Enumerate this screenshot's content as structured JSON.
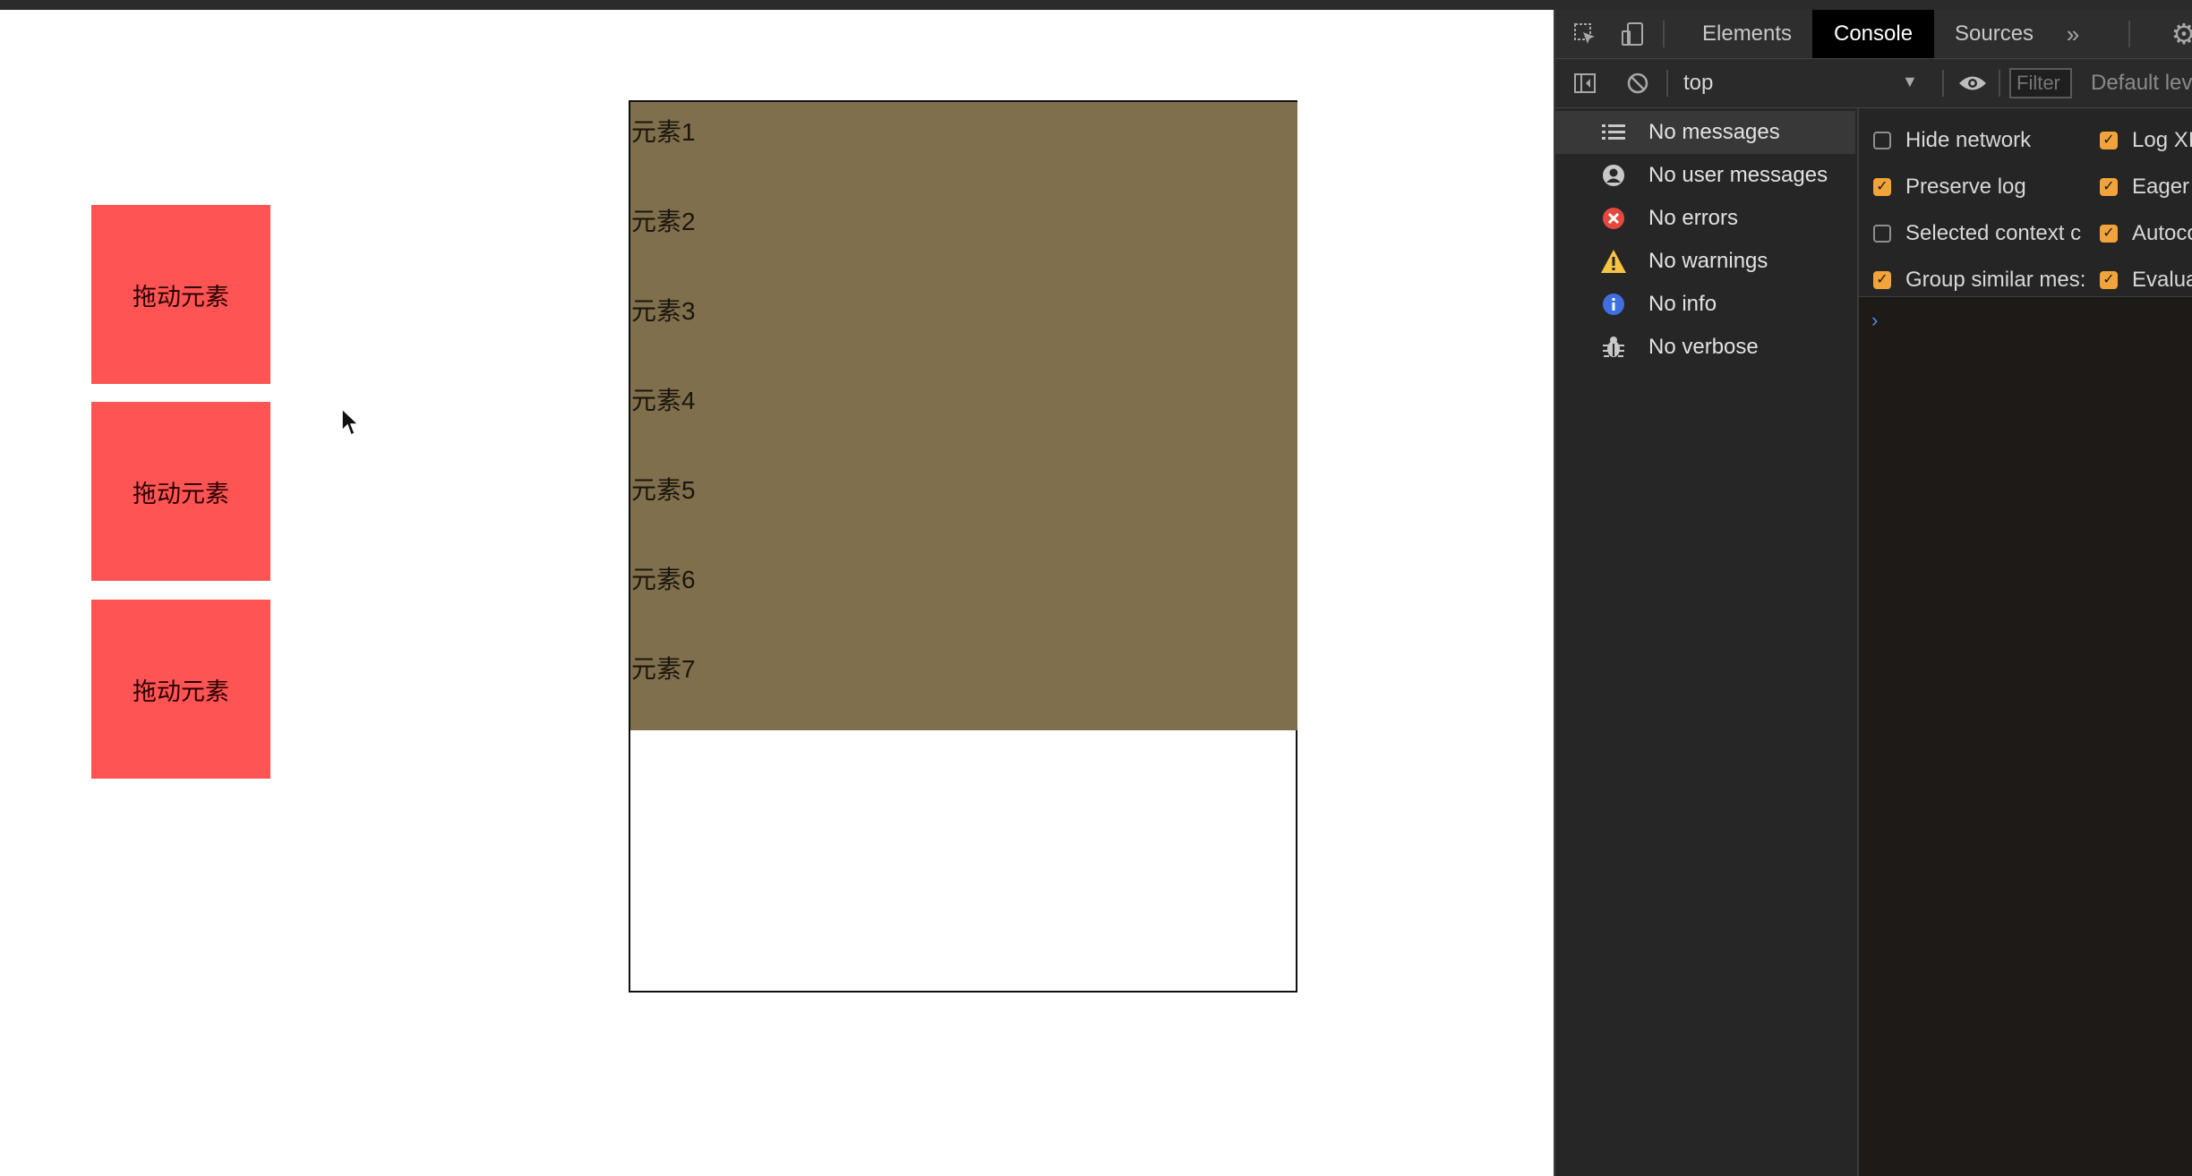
{
  "page": {
    "drag_items": [
      "拖动元素",
      "拖动元素",
      "拖动元素"
    ],
    "list_items": [
      "元素1",
      "元素2",
      "元素3",
      "元素4",
      "元素5",
      "元素6",
      "元素7"
    ]
  },
  "devtools": {
    "tabs": [
      {
        "label": "Elements",
        "active": false
      },
      {
        "label": "Console",
        "active": true
      },
      {
        "label": "Sources",
        "active": false
      }
    ],
    "more_tabs_icon": "chevron-double-right-icon",
    "toolbar": {
      "context": "top",
      "filter_placeholder": "Filter",
      "levels": "Default lev"
    },
    "sidebar": [
      {
        "label": "No messages",
        "icon": "list-icon",
        "selected": true
      },
      {
        "label": "No user messages",
        "icon": "user-icon",
        "selected": false
      },
      {
        "label": "No errors",
        "icon": "error-icon",
        "selected": false
      },
      {
        "label": "No warnings",
        "icon": "warning-icon",
        "selected": false
      },
      {
        "label": "No info",
        "icon": "info-icon",
        "selected": false
      },
      {
        "label": "No verbose",
        "icon": "bug-icon",
        "selected": false
      }
    ],
    "settings": {
      "left": [
        {
          "label": "Hide network",
          "checked": false
        },
        {
          "label": "Preserve log",
          "checked": true
        },
        {
          "label": "Selected context c",
          "checked": false
        },
        {
          "label": "Group similar mes:",
          "checked": true
        }
      ],
      "right": [
        {
          "label": "Log XI",
          "checked": true
        },
        {
          "label": "Eager",
          "checked": true
        },
        {
          "label": "Autoco",
          "checked": true
        },
        {
          "label": "Evalua",
          "checked": true
        }
      ]
    },
    "prompt": "›"
  },
  "colors": {
    "drag_box": "#ff5454",
    "list_area": "#7f6f4d",
    "checkbox_on": "#f2a33a",
    "error": "#e5483f",
    "warning": "#f6c343",
    "info": "#3f6fe0"
  }
}
